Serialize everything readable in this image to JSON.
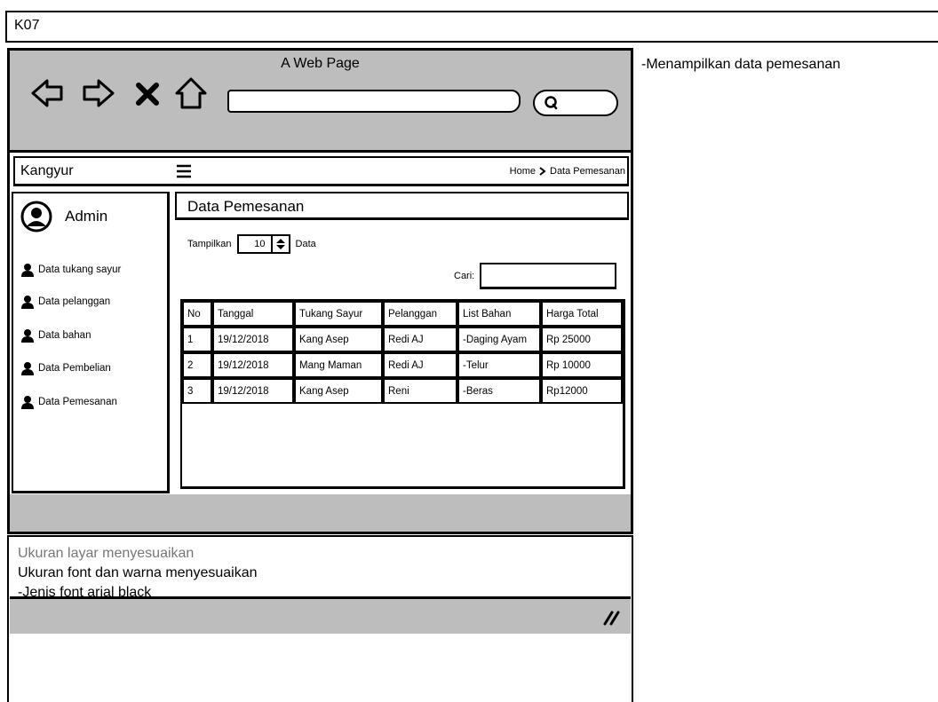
{
  "window": {
    "title": "K07"
  },
  "browser": {
    "page_title": "A Web Page",
    "url_value": "",
    "search_value": ""
  },
  "app": {
    "brand": "Kangyur",
    "breadcrumb": {
      "home": "Home",
      "current": "Data Pemesanan"
    }
  },
  "sidebar": {
    "user": "Admin",
    "items": [
      {
        "label": "Data tukang sayur"
      },
      {
        "label": "Data pelanggan"
      },
      {
        "label": "Data bahan"
      },
      {
        "label": "Data Pembelian"
      },
      {
        "label": "Data Pemesanan"
      }
    ]
  },
  "main": {
    "title": "Data Pemesanan",
    "show_prefix": "Tampilkan",
    "show_value": "10",
    "show_suffix": "Data",
    "search_label": "Cari:",
    "search_value": "",
    "table": {
      "headers": [
        "No",
        "Tanggal",
        "Tukang Sayur",
        "Pelanggan",
        "List Bahan",
        "Harga Total"
      ],
      "rows": [
        [
          "1",
          "19/12/2018",
          "Kang Asep",
          "Redi AJ",
          "-Daging Ayam",
          "Rp 25000"
        ],
        [
          "2",
          "19/12/2018",
          "Mang Maman",
          "Redi AJ",
          "-Telur",
          "Rp 10000"
        ],
        [
          "3",
          "19/12/2018",
          "Kang Asep",
          "Reni",
          "-Beras",
          "Rp12000"
        ]
      ]
    }
  },
  "notes": {
    "line1": "Ukuran layar menyesuaikan",
    "line2": "Ukuran font dan warna menyesuaikan",
    "line3": "-Jenis font arial black"
  },
  "description": "-Menampilkan data pemesanan",
  "colors": {
    "chrome_gray": "#bdbdbd",
    "muted_text": "#777777"
  }
}
